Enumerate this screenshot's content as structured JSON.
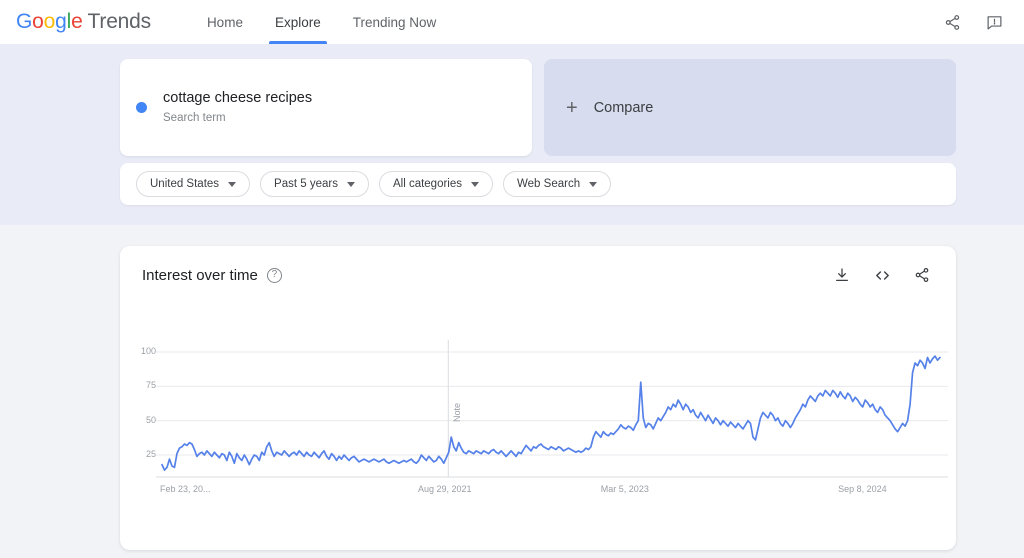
{
  "app": {
    "brand_google": [
      "G",
      "o",
      "o",
      "g",
      "l",
      "e"
    ],
    "brand_word": "Trends"
  },
  "nav": {
    "items": [
      {
        "label": "Home",
        "active": false
      },
      {
        "label": "Explore",
        "active": true
      },
      {
        "label": "Trending Now",
        "active": false
      }
    ],
    "share_icon": "share-icon",
    "feedback_icon": "feedback-icon"
  },
  "query": {
    "term": "cottage cheese recipes",
    "term_type": "Search term",
    "term_color": "#4285f4",
    "compare_label": "Compare",
    "compare_plus": "+"
  },
  "filters": [
    {
      "label": "United States"
    },
    {
      "label": "Past 5 years"
    },
    {
      "label": "All categories"
    },
    {
      "label": "Web Search"
    }
  ],
  "chart_card": {
    "title": "Interest over time",
    "help_glyph": "?",
    "actions": [
      {
        "name": "download-icon",
        "label": "Download CSV"
      },
      {
        "name": "embed-icon",
        "label": "<>"
      },
      {
        "name": "share-icon",
        "label": "Share"
      }
    ]
  },
  "chart_data": {
    "type": "line",
    "title": "Interest over time",
    "xlabel": "",
    "ylabel": "",
    "ylim": [
      0,
      100
    ],
    "yticks": [
      25,
      50,
      75,
      100
    ],
    "ytick_labels": [
      "25",
      "50",
      "75",
      "100"
    ],
    "grid": true,
    "legend": false,
    "series_color": "#5581e8",
    "xtick_labels": [
      "Feb 23, 20...",
      "Aug 29, 2021",
      "Mar 5, 2023",
      "Sep 8, 2024"
    ],
    "xtick_positions": [
      0,
      0.365,
      0.6,
      0.905
    ],
    "annotations": [
      {
        "label": "Note",
        "x": 0.368,
        "type": "vertical-line"
      }
    ],
    "series": [
      {
        "name": "cottage cheese recipes",
        "values": [
          18,
          14,
          16,
          22,
          17,
          16,
          26,
          30,
          31,
          33,
          32,
          34,
          33,
          29,
          24,
          26,
          27,
          25,
          28,
          26,
          24,
          27,
          25,
          23,
          26,
          25,
          21,
          27,
          24,
          19,
          26,
          23,
          21,
          25,
          22,
          18,
          22,
          25,
          24,
          21,
          27,
          25,
          31,
          34,
          28,
          24,
          27,
          26,
          25,
          28,
          26,
          24,
          26,
          27,
          25,
          28,
          26,
          24,
          27,
          25,
          24,
          27,
          25,
          23,
          26,
          28,
          24,
          22,
          26,
          24,
          21,
          24,
          22,
          25,
          23,
          21,
          23,
          24,
          22,
          20,
          21,
          22,
          21,
          20,
          21,
          22,
          21,
          20,
          21,
          22,
          20,
          19,
          20,
          21,
          20,
          19,
          20,
          21,
          20,
          21,
          22,
          20,
          19,
          21,
          25,
          23,
          21,
          24,
          22,
          20,
          21,
          24,
          22,
          19,
          23,
          27,
          38,
          31,
          28,
          34,
          30,
          27,
          26,
          28,
          27,
          26,
          28,
          27,
          26,
          28,
          27,
          26,
          28,
          29,
          27,
          26,
          28,
          26,
          24,
          26,
          28,
          26,
          24,
          27,
          26,
          29,
          32,
          30,
          28,
          31,
          30,
          32,
          33,
          31,
          30,
          29,
          31,
          30,
          29,
          31,
          30,
          28,
          29,
          30,
          29,
          28,
          27,
          28,
          27,
          28,
          30,
          29,
          31,
          38,
          42,
          40,
          38,
          42,
          40,
          39,
          41,
          40,
          42,
          44,
          47,
          45,
          44,
          46,
          45,
          43,
          47,
          50,
          78,
          52,
          45,
          48,
          47,
          44,
          48,
          52,
          50,
          53,
          56,
          60,
          58,
          62,
          60,
          65,
          62,
          58,
          62,
          60,
          56,
          58,
          54,
          52,
          56,
          53,
          50,
          54,
          51,
          48,
          52,
          50,
          47,
          50,
          48,
          46,
          49,
          47,
          45,
          48,
          46,
          44,
          47,
          50,
          48,
          38,
          36,
          44,
          52,
          56,
          54,
          52,
          56,
          54,
          50,
          52,
          48,
          46,
          50,
          48,
          45,
          48,
          52,
          55,
          58,
          62,
          60,
          65,
          68,
          66,
          64,
          68,
          70,
          68,
          72,
          70,
          68,
          72,
          70,
          67,
          71,
          68,
          66,
          70,
          68,
          64,
          67,
          65,
          62,
          60,
          65,
          63,
          60,
          62,
          58,
          56,
          60,
          58,
          54,
          52,
          50,
          47,
          44,
          42,
          45,
          48,
          46,
          50,
          62,
          85,
          92,
          90,
          94,
          92,
          88,
          96,
          92,
          95,
          97,
          94,
          96
        ]
      }
    ]
  }
}
